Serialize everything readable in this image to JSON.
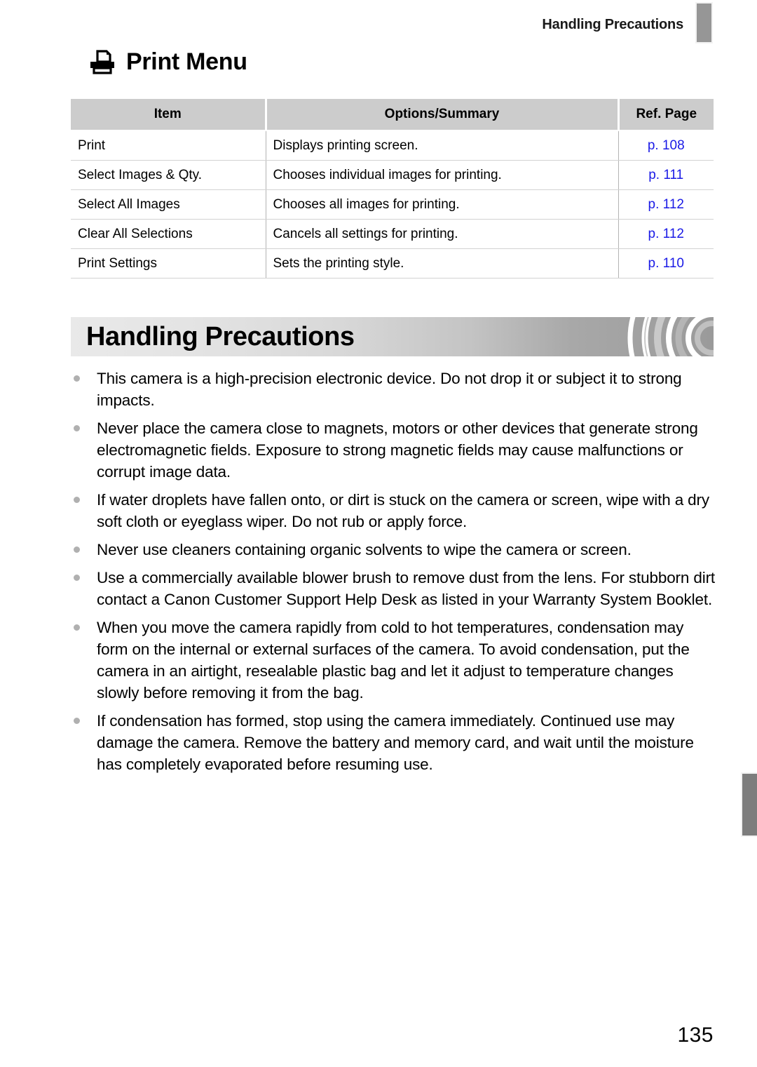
{
  "running_header": "Handling Precautions",
  "section": {
    "icon": "printer-icon",
    "title": "Print Menu"
  },
  "table": {
    "columns": [
      "Item",
      "Options/Summary",
      "Ref. Page"
    ],
    "rows": [
      {
        "item": "Print",
        "options": "Displays printing screen.",
        "ref": "p. 108"
      },
      {
        "item": "Select Images & Qty.",
        "options": "Chooses individual images for printing.",
        "ref": "p. 111"
      },
      {
        "item": "Select All Images",
        "options": "Chooses all images for printing.",
        "ref": "p. 112"
      },
      {
        "item": "Clear All Selections",
        "options": "Cancels all settings for printing.",
        "ref": "p. 112"
      },
      {
        "item": "Print Settings",
        "options": "Sets the printing style.",
        "ref": "p. 110"
      }
    ]
  },
  "chapter": {
    "title": "Handling Precautions"
  },
  "precautions": [
    "This camera is a high-precision electronic device. Do not drop it or subject it to strong impacts.",
    "Never place the camera close to magnets, motors or other devices that generate strong electromagnetic fields. Exposure to strong magnetic fields may cause malfunctions or corrupt image data.",
    "If water droplets have fallen onto, or dirt is stuck on the camera or screen, wipe with a dry soft cloth or eyeglass wiper. Do not rub or apply force.",
    "Never use cleaners containing organic solvents to wipe the camera or screen.",
    "Use a commercially available blower brush to remove dust from the lens. For stubborn dirt contact a Canon Customer Support Help Desk as listed in your Warranty System Booklet.",
    "When you move the camera rapidly from cold to hot temperatures, condensation may form on the internal or external surfaces of the camera. To avoid condensation, put the camera in an airtight, resealable plastic bag and let it adjust to temperature changes slowly before removing it from the bag.",
    "If condensation has formed, stop using the camera immediately. Continued use may damage the camera. Remove the battery and memory card, and wait until the moisture has completely evaporated before resuming use."
  ],
  "page_number": "135",
  "colors": {
    "table_header_bg": "#cccccc",
    "ref_link": "#1a1ae6",
    "tab_marker": "#969696",
    "bullet": "#b0b0b0"
  }
}
